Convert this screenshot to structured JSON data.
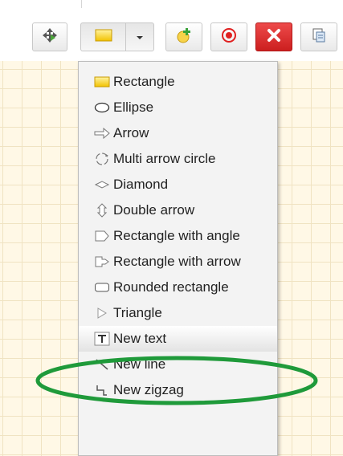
{
  "menu": {
    "items": [
      {
        "id": "rectangle",
        "label": "Rectangle",
        "icon": "rectangle-icon"
      },
      {
        "id": "ellipse",
        "label": "Ellipse",
        "icon": "ellipse-icon"
      },
      {
        "id": "arrow",
        "label": "Arrow",
        "icon": "arrow-icon"
      },
      {
        "id": "multi-arrow-circle",
        "label": "Multi arrow circle",
        "icon": "multi-arrow-circle-icon"
      },
      {
        "id": "diamond",
        "label": "Diamond",
        "icon": "diamond-icon"
      },
      {
        "id": "double-arrow",
        "label": "Double arrow",
        "icon": "double-arrow-icon"
      },
      {
        "id": "rectangle-with-angle",
        "label": "Rectangle with angle",
        "icon": "rectangle-with-angle-icon"
      },
      {
        "id": "rectangle-with-arrow",
        "label": "Rectangle with arrow",
        "icon": "rectangle-with-arrow-icon"
      },
      {
        "id": "rounded-rectangle",
        "label": "Rounded rectangle",
        "icon": "rounded-rectangle-icon"
      },
      {
        "id": "triangle",
        "label": "Triangle",
        "icon": "triangle-icon"
      },
      {
        "id": "new-text",
        "label": "New text",
        "icon": "text-icon",
        "highlighted": true
      },
      {
        "id": "new-line",
        "label": "New line",
        "icon": "line-icon"
      },
      {
        "id": "new-zigzag",
        "label": "New zigzag",
        "icon": "zigzag-icon"
      }
    ]
  },
  "toolbar": {
    "buttons": [
      {
        "id": "move",
        "icon": "move-arrows-icon"
      },
      {
        "id": "shape",
        "icon": "rectangle-shape-icon"
      },
      {
        "id": "shape-dropdown",
        "icon": "caret-down-icon"
      },
      {
        "id": "add",
        "icon": "add-shape-icon"
      },
      {
        "id": "record",
        "icon": "target-icon"
      },
      {
        "id": "delete",
        "icon": "close-icon"
      },
      {
        "id": "copy",
        "icon": "copy-icon"
      }
    ]
  },
  "colors": {
    "highlight_ring": "#1f9a3a",
    "delete_red": "#d92a2a",
    "canvas_bg": "#fff8e6",
    "menu_bg": "#f3f3f3"
  }
}
